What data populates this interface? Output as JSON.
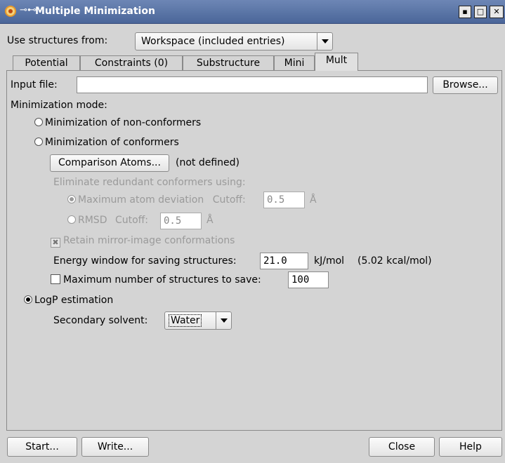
{
  "window": {
    "title": "Multiple Minimization",
    "pin_glyph": "⊸⊷"
  },
  "structures": {
    "label": "Use structures from:",
    "value": "Workspace (included entries)"
  },
  "tabs": [
    {
      "label": "Potential"
    },
    {
      "label": "Constraints (0)"
    },
    {
      "label": "Substructure"
    },
    {
      "label": "Mini"
    },
    {
      "label": "Mult"
    }
  ],
  "input_file": {
    "label": "Input file:",
    "value": "",
    "browse_label": "Browse..."
  },
  "mode": {
    "label": "Minimization mode:",
    "non_conformers": "Minimization of non-conformers",
    "conformers": "Minimization of conformers",
    "comparison_button": "Comparison Atoms...",
    "comparison_status": "(not defined)",
    "eliminate_label": "Eliminate redundant conformers using:",
    "max_dev_label": "Maximum atom deviation",
    "cutoff_label": "Cutoff:",
    "max_dev_cutoff": "0.5",
    "unit_angstrom": "Å",
    "rmsd_label": "RMSD",
    "rmsd_cutoff": "0.5",
    "retain_mirror": "Retain mirror-image conformations",
    "energy_label": "Energy window for saving structures:",
    "energy_value": "21.0",
    "energy_units": "kJ/mol",
    "energy_kcal": "(5.02 kcal/mol)",
    "max_structures_label": "Maximum number of structures to save:",
    "max_structures_value": "100",
    "logp_label": "LogP estimation",
    "solvent_label": "Secondary solvent:",
    "solvent_value": "Water"
  },
  "buttons": {
    "start": "Start...",
    "write": "Write...",
    "close": "Close",
    "help": "Help"
  },
  "state": {
    "selected_mode": "logp",
    "max_atom_deviation_selected": true,
    "retain_mirror_checked": true,
    "max_structures_checked": false
  }
}
